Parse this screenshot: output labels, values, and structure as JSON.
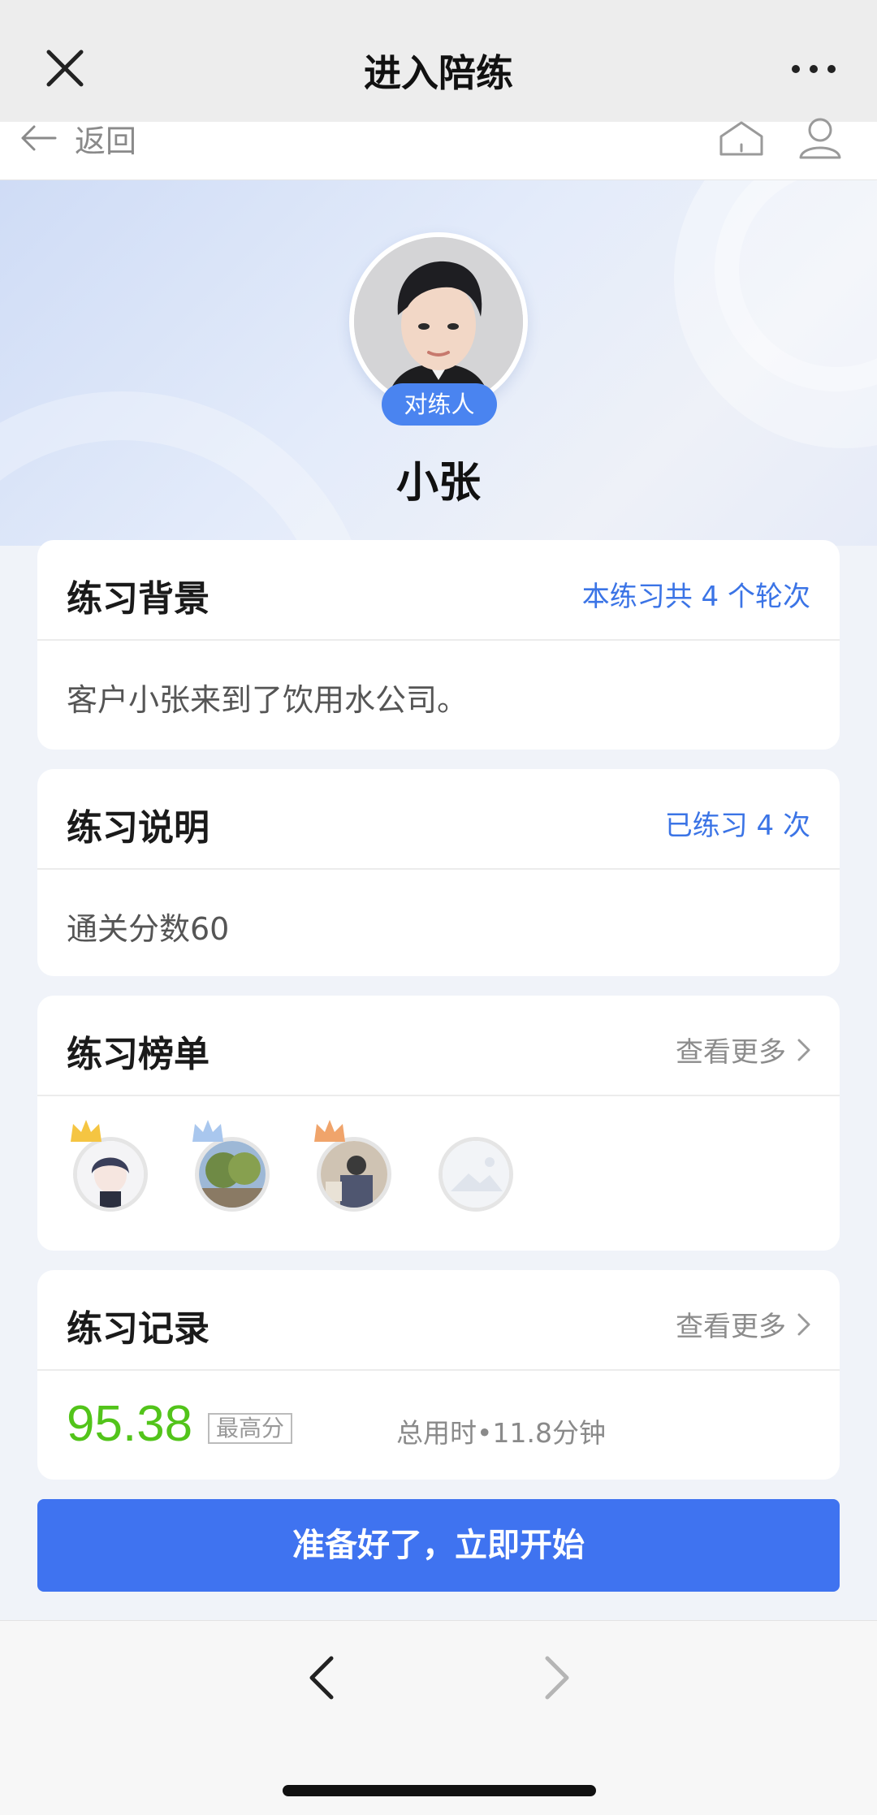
{
  "titlebar": {
    "title": "进入陪练",
    "close_icon": "close-icon",
    "more_icon": "more-icon"
  },
  "nav": {
    "back_label": "返回",
    "home_icon": "home-icon",
    "user_icon": "user-icon"
  },
  "profile": {
    "role_label": "对练人",
    "name": "小张"
  },
  "background_card": {
    "title": "练习背景",
    "meta": "本练习共 4 个轮次",
    "content": "客户小张来到了饮用水公司。"
  },
  "instructions_card": {
    "title": "练习说明",
    "meta": "已练习 4 次",
    "content": "通关分数60"
  },
  "ranking_card": {
    "title": "练习榜单",
    "more_label": "查看更多",
    "entries": [
      {
        "rank": 1,
        "crown_color": "#f5c542"
      },
      {
        "rank": 2,
        "crown_color": "#a9c7ee"
      },
      {
        "rank": 3,
        "crown_color": "#f0a46b"
      },
      {
        "rank": 4,
        "crown_color": ""
      }
    ]
  },
  "records_card": {
    "title": "练习记录",
    "more_label": "查看更多",
    "best_score": "95.38",
    "best_score_tag": "最高分",
    "total_time": "总用时•11.8分钟"
  },
  "start_button": {
    "label": "准备好了，立即开始"
  },
  "colors": {
    "accent": "#3f73f0",
    "link_blue": "#3b74e6",
    "score_green": "#52c41a"
  }
}
